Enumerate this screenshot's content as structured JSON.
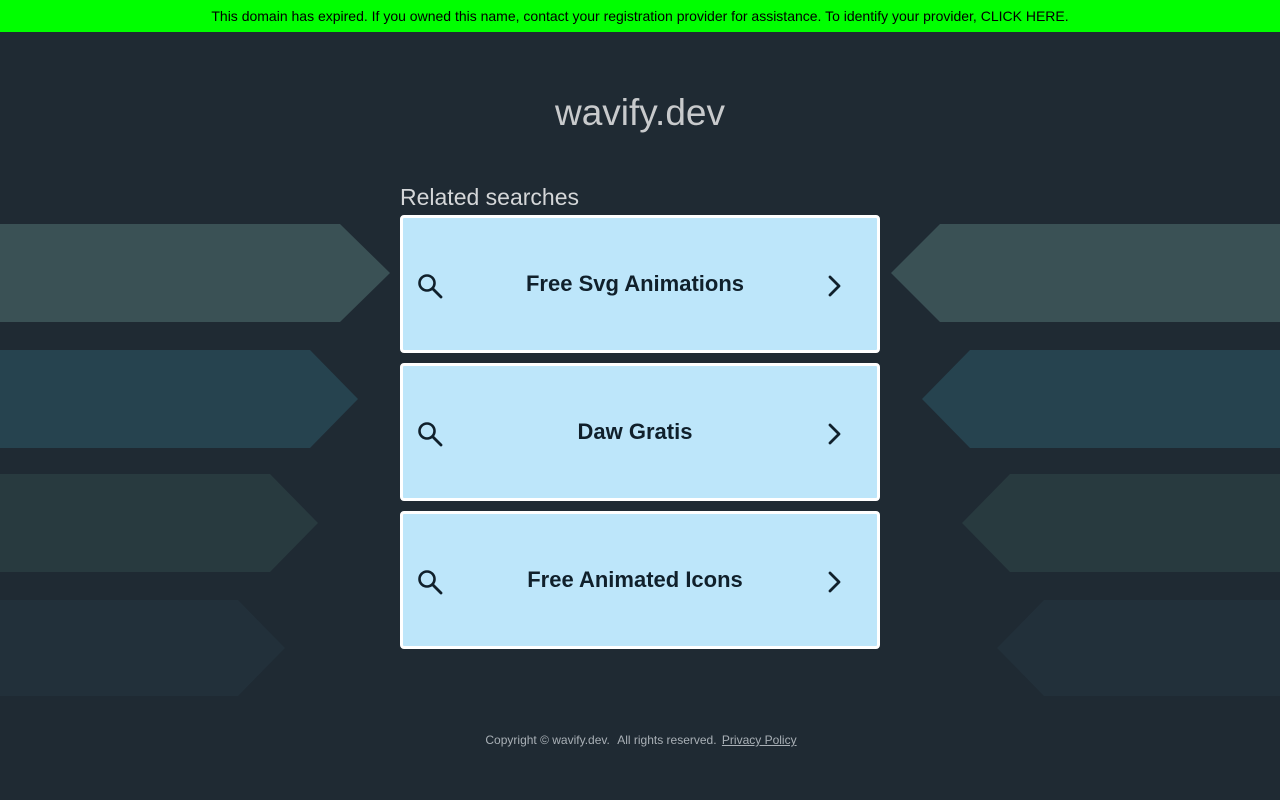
{
  "banner": {
    "text": "This domain has expired. If you owned this name, contact your registration provider for assistance. To identify your provider, CLICK HERE."
  },
  "domain": {
    "title": "wavify.dev"
  },
  "related": {
    "heading": "Related searches",
    "items": [
      {
        "label": "Free Svg Animations"
      },
      {
        "label": "Daw Gratis"
      },
      {
        "label": "Free Animated Icons"
      }
    ]
  },
  "footer": {
    "copyright": "Copyright © wavify.dev.",
    "rights": "All rights reserved.",
    "privacy_link": "Privacy Policy"
  },
  "colors": {
    "background": "#1f2a33",
    "banner": "#00ff00",
    "card": "#bde6fa",
    "card_border": "#ffffff"
  },
  "icons": {
    "search": "search-icon",
    "chevron": "chevron-right-icon"
  }
}
